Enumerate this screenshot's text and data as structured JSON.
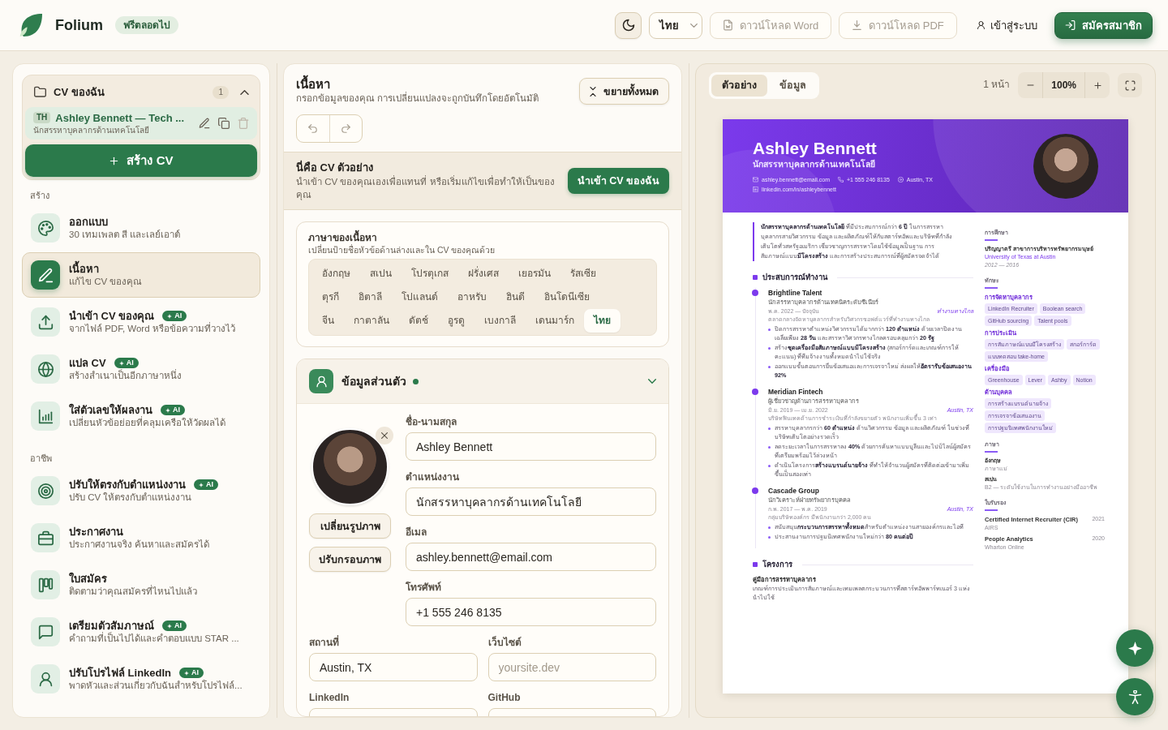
{
  "topbar": {
    "brand": "Folium",
    "badge": "ฟรีตลอดไป",
    "language": "ไทย",
    "actions": [
      {
        "kind": "word",
        "label": "ดาวน์โหลด Word",
        "disabled": true
      },
      {
        "kind": "pdf",
        "label": "ดาวน์โหลด PDF",
        "disabled": true
      },
      {
        "kind": "login",
        "label": "เข้าสู่ระบบ",
        "disabled": false
      },
      {
        "kind": "signup",
        "label": "สมัครสมาชิก",
        "disabled": false
      }
    ]
  },
  "sidebar": {
    "my_cvs": {
      "title": "CV ของฉัน",
      "count": "1",
      "expanded": true,
      "items": [
        {
          "language": "TH",
          "title": "Ashley Bennett — Tech ...",
          "subtitle": "นักสรรหาบุคลากรด้านเทคโนโลยี",
          "selected": true
        }
      ],
      "create_button": "สร้าง CV"
    },
    "sections": [
      {
        "heading": "สร้าง",
        "items": [
          {
            "kind": "design",
            "title": "ออกแบบ",
            "subtitle": "30 เทมเพลต สี และเลย์เอาต์",
            "selected": false
          },
          {
            "kind": "content",
            "title": "เนื้อหา",
            "subtitle": "แก้ไข CV ของคุณ",
            "selected": true
          },
          {
            "kind": "import",
            "title": "นำเข้า CV ของคุณ",
            "badge": "AI",
            "subtitle": "จากไฟล์ PDF, Word หรือข้อความที่วางไว้",
            "selected": false
          },
          {
            "kind": "translate",
            "title": "แปล CV",
            "badge": "AI",
            "subtitle": "สร้างสำเนาเป็นอีกภาษาหนึ่ง",
            "selected": false
          },
          {
            "kind": "quantify",
            "title": "ใส่ตัวเลขให้ผลงาน",
            "badge": "AI",
            "subtitle": "เปลี่ยนหัวข้อย่อยที่คลุมเครือให้วัดผลได้",
            "selected": false
          }
        ]
      },
      {
        "heading": "อาชีพ",
        "items": [
          {
            "kind": "tailor",
            "title": "ปรับให้ตรงกับตำแหน่งงาน",
            "badge": "AI",
            "subtitle": "ปรับ CV ให้ตรงกับตำแหน่งงาน",
            "selected": false
          },
          {
            "kind": "jobs",
            "title": "ประกาศงาน",
            "subtitle": "ประกาศงานจริง ค้นหาและสมัครได้",
            "selected": false
          },
          {
            "kind": "applications",
            "title": "ใบสมัคร",
            "subtitle": "ติดตามว่าคุณสมัครที่ไหนไปแล้ว",
            "selected": false
          },
          {
            "kind": "interview",
            "title": "เตรียมตัวสัมภาษณ์",
            "badge": "AI",
            "subtitle": "คำถามที่เป็นไปได้และคำตอบแบบ STAR ...",
            "selected": false
          },
          {
            "kind": "linkedin",
            "title": "ปรับโปรไฟล์ LinkedIn",
            "badge": "AI",
            "subtitle": "พาดหัวและส่วนเกี่ยวกับฉันสำหรับโปรไฟล์...",
            "selected": false
          }
        ]
      }
    ]
  },
  "editor": {
    "title": "เนื้อหา",
    "subtitle": "กรอกข้อมูลของคุณ การเปลี่ยนแปลงจะถูกบันทึกโดยอัตโนมัติ",
    "expand_all": "ขยายทั้งหมด",
    "sample_notice": {
      "title": "นี่คือ CV ตัวอย่าง",
      "text": "นำเข้า CV ของคุณเองเพื่อแทนที่ หรือเริ่มแก้ไขเพื่อทำให้เป็นของคุณ",
      "button": "นำเข้า CV ของฉัน"
    },
    "content_language": {
      "title": "ภาษาของเนื้อหา",
      "subtitle": "เปลี่ยนป้ายชื่อหัวข้อด้านล่างและใน CV ของคุณด้วย",
      "rows": [
        [
          {
            "label": "อังกฤษ",
            "selected": false
          },
          {
            "label": "สเปน",
            "selected": false
          },
          {
            "label": "โปรตุเกส",
            "selected": false
          },
          {
            "label": "ฝรั่งเศส",
            "selected": false
          },
          {
            "label": "เยอรมัน",
            "selected": false
          },
          {
            "label": "รัสเซีย",
            "selected": false
          }
        ],
        [
          {
            "label": "ตุรกี",
            "selected": false
          },
          {
            "label": "อิตาลี",
            "selected": false
          },
          {
            "label": "โปแลนด์",
            "selected": false
          },
          {
            "label": "อาหรับ",
            "selected": false
          },
          {
            "label": "ฮินดี",
            "selected": false
          },
          {
            "label": "อินโดนีเซีย",
            "selected": false
          }
        ],
        [
          {
            "label": "จีน",
            "selected": false
          },
          {
            "label": "กาตาลัน",
            "selected": false
          },
          {
            "label": "ดัตช์",
            "selected": false
          },
          {
            "label": "อูรดู",
            "selected": false
          },
          {
            "label": "เบงกาลี",
            "selected": false
          },
          {
            "label": "เดนมาร์ก",
            "selected": false
          },
          {
            "label": "ไทย",
            "selected": true
          }
        ]
      ]
    },
    "personal_info": {
      "title": "ข้อมูลส่วนตัว",
      "complete": true,
      "expanded": true,
      "photo_actions": [
        "เปลี่ยนรูปภาพ",
        "ปรับกรอบภาพ"
      ],
      "main_fields": [
        {
          "label": "ชื่อ-นามสกุล",
          "value": "Ashley Bennett"
        },
        {
          "label": "ตำแหน่งงาน",
          "value": "นักสรรหาบุคลากรด้านเทคโนโลยี"
        },
        {
          "label": "อีเมล",
          "value": "ashley.bennett@email.com"
        },
        {
          "label": "โทรศัพท์",
          "value": "+1 555 246 8135"
        }
      ],
      "fields": [
        {
          "label": "สถานที่",
          "value": "Austin, TX"
        },
        {
          "label": "เว็บไซต์",
          "placeholder": "yoursite.dev"
        },
        {
          "label": "LinkedIn"
        },
        {
          "label": "GitHub"
        }
      ]
    }
  },
  "preview": {
    "tabs": [
      {
        "label": "ตัวอย่าง",
        "selected": true
      },
      {
        "label": "ข้อมูล",
        "selected": false
      }
    ],
    "page_count": "1 หน้า",
    "zoom": "100%",
    "cv": {
      "name": "Ashley Bennett",
      "headline": "นักสรรหาบุคลากรด้านเทคโนโลยี",
      "contacts": [
        {
          "kind": "email",
          "text": "ashley.bennett@email.com"
        },
        {
          "kind": "phone",
          "text": "+1 555 246 8135"
        },
        {
          "kind": "location",
          "text": "Austin, TX"
        },
        {
          "kind": "linkedin",
          "text": "linkedin.com/in/ashleybennett"
        }
      ],
      "summary": "**นักสรรหาบุคลากรด้านเทคโนโลยี** ที่มีประสบการณ์กว่า **6 ปี** ในการสรรหาบุคลากรสายวิศวกรรม ข้อมูล และผลิตภัณฑ์ให้กับสตาร์ทอัพและบริษัทที่กำลังเติบโตทั่วสหรัฐอเมริกา เชี่ยวชาญการสรรหาโดยใช้ข้อมูลเป็นฐาน การสัมภาษณ์แบบ**มีโครงสร้าง** และการสร้างประสบการณ์ที่ผู้สมัครจดจำได้",
      "main_sections": [
        {
          "kind": "experience",
          "title": "ประสบการณ์ทำงาน",
          "entries": [
            {
              "company": "Brightline Talent",
              "role": "นักสรรหาบุคลากรด้านเทคนิคระดับซีเนียร์",
              "dates": "พ.ค. 2022 — ปัจจุบัน",
              "location": "ทำงานทางไกล",
              "description": "ตลาดกลางจัดหาบุคลากรสำหรับวิศวกรซอฟต์แวร์ที่ทำงานทางไกล",
              "bullets": [
                "ปิดการสรรหาตำแหน่งวิศวกรรมได้มากกว่า **120 ตำแหน่ง** ด้วยเวลาปิดงานเฉลี่ยเพียง **28 วัน** และสรรหาวิศวกรทางไกลครอบคลุมกว่า **20 รัฐ**",
                "สร้าง**ชุดเครื่องมือสัมภาษณ์แบบมีโครงสร้าง** (สกอร์การ์ดและเกณฑ์การให้คะแนน) ที่ทีมจ้างงานทั้งหมดนำไปใช้จริง",
                "ออกแบบขั้นตอนการยื่นข้อเสนอและการเจรจาใหม่ ส่งผลให้**อัตรารับข้อเสนองาน 92%**"
              ]
            },
            {
              "company": "Meridian Fintech",
              "role": "ผู้เชี่ยวชาญด้านการสรรหาบุคลากร",
              "dates": "มิ.ย. 2019 — เม.ย. 2022",
              "location": "Austin, TX",
              "description": "บริษัทฟินเทคด้านการชำระเงินที่กำลังขยายตัว พนักงานเพิ่มขึ้น 3 เท่า",
              "bullets": [
                "สรรหาบุคลากรกว่า **60 ตำแหน่ง** ด้านวิศวกรรม ข้อมูล และผลิตภัณฑ์ ในช่วงที่บริษัทเติบโตอย่างรวดเร็ว",
                "ลดระยะเวลาในการสรรหาลง **40%** ด้วยการค้นหาแบบบูลีนและไปป์ไลน์ผู้สมัครที่เตรียมพร้อมไว้ล่วงหน้า",
                "ดำเนินโครงการ**สร้างแบรนด์นายจ้าง** ที่ทำให้จำนวนผู้สมัครที่ติดต่อเข้ามาเพิ่มขึ้นเป็นสองเท่า"
              ]
            },
            {
              "company": "Cascade Group",
              "role": "นักวิเคราะห์ฝ่ายทรัพยากรบุคคล",
              "dates": "ก.พ. 2017 — พ.ค. 2019",
              "location": "Austin, TX",
              "description": "กลุ่มบริษัทองค์กร มีพนักงานกว่า 2,000 คน",
              "bullets": [
                "สนับสนุน**กระบวนการสรรหาทั้งหมด**สำหรับตำแหน่งงานสายองค์กรและไอที",
                "ประสานงานการปฐมนิเทศพนักงานใหม่กว่า **80 คนต่อปี**"
              ]
            }
          ]
        },
        {
          "kind": "projects",
          "title": "โครงการ",
          "entries": [
            {
              "name": "คู่มือการสรรหาบุคลากร",
              "description": "เกณฑ์การประเมินการสัมภาษณ์และเทมเพลตกระบวนการที่สตาร์ทอัพพาร์ทเนอร์ 3 แห่งนำไปใช้"
            }
          ]
        }
      ],
      "side_sections": [
        {
          "kind": "education",
          "title": "การศึกษา",
          "items": [
            {
              "degree": "ปริญญาตรี สาขาการบริหารทรัพยากรมนุษย์",
              "school": "University of Texas at Austin",
              "years": "2012 — 2016"
            }
          ]
        },
        {
          "kind": "skills",
          "title": "ทักษะ",
          "groups": [
            {
              "name": "การจัดหาบุคลากร",
              "tags": [
                "LinkedIn Recruiter",
                "Boolean search",
                "GitHub sourcing",
                "Talent pools"
              ]
            },
            {
              "name": "การประเมิน",
              "tags": [
                "การสัมภาษณ์แบบมีโครงสร้าง",
                "สกอร์การ์ด",
                "แบบทดสอบ take-home"
              ]
            },
            {
              "name": "เครื่องมือ",
              "tags": [
                "Greenhouse",
                "Lever",
                "Ashby",
                "Notion"
              ]
            },
            {
              "name": "ด้านบุคคล",
              "tags": [
                "การสร้างแบรนด์นายจ้าง",
                "การเจรจาข้อเสนองาน",
                "การปฐมนิเทศพนักงานใหม่"
              ]
            }
          ]
        },
        {
          "kind": "languages",
          "title": "ภาษา",
          "items": [
            {
              "name": "อังกฤษ",
              "proficiency": "ภาษาแม่"
            },
            {
              "name": "สเปน",
              "proficiency": "B2 — ระดับใช้งานในการทำงานอย่างมืออาชีพ"
            }
          ]
        },
        {
          "kind": "certifications",
          "title": "ใบรับรอง",
          "items": [
            {
              "name": "Certified Internet Recruiter (CIR)",
              "issuer": "AIRS",
              "year": "2021"
            },
            {
              "name": "People Analytics",
              "issuer": "Wharton Online",
              "year": "2020"
            }
          ]
        }
      ]
    }
  }
}
